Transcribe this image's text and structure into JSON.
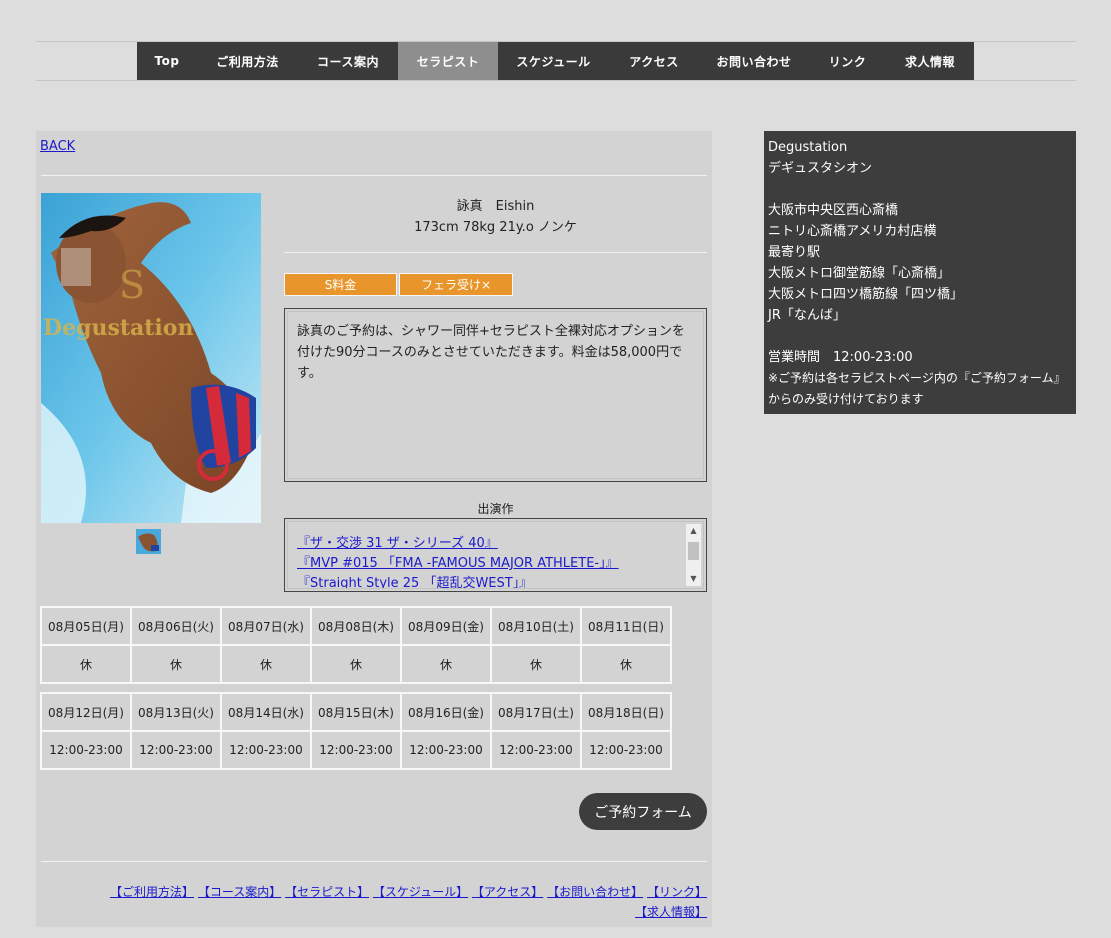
{
  "nav": {
    "items": [
      {
        "label": "Top",
        "name": "nav-top",
        "width": 60
      },
      {
        "label": "ご利用方法",
        "name": "nav-usage",
        "width": 101
      },
      {
        "label": "コース案内",
        "name": "nav-courses",
        "width": 100
      },
      {
        "label": "セラピスト",
        "name": "nav-therapist",
        "width": 100,
        "active": true
      },
      {
        "label": "スケジュール",
        "name": "nav-schedule",
        "width": 111
      },
      {
        "label": "アクセス",
        "name": "nav-access",
        "width": 90
      },
      {
        "label": "お問い合わせ",
        "name": "nav-contact",
        "width": 110
      },
      {
        "label": "リンク",
        "name": "nav-link",
        "width": 77
      },
      {
        "label": "求人情報",
        "name": "nav-recruit",
        "width": 88
      }
    ]
  },
  "back_label": "BACK",
  "profile": {
    "name": "詠真　Eishin",
    "stats": "173cm 78kg 21y.o ノンケ",
    "tags": [
      "S料金",
      "フェラ受け×"
    ],
    "description": "詠真のご予約は、シャワー同伴+セラピスト全裸対応オプションを付けた90分コースのみとさせていただきます。料金は58,000円です。",
    "logo_text": "Degustation"
  },
  "films": {
    "title": "出演作",
    "items": [
      "『ザ・交渉 31 ザ・シリーズ 40』",
      "『MVP #015 「FMA -FAMOUS MAJOR ATHLETE-」』",
      "『Straight Style 25 「超乱交WEST」』"
    ]
  },
  "schedule": {
    "week1": {
      "dates": [
        "08月05日(月)",
        "08月06日(火)",
        "08月07日(水)",
        "08月08日(木)",
        "08月09日(金)",
        "08月10日(土)",
        "08月11日(日)"
      ],
      "hours": [
        "休",
        "休",
        "休",
        "休",
        "休",
        "休",
        "休"
      ]
    },
    "week2": {
      "dates": [
        "08月12日(月)",
        "08月13日(火)",
        "08月14日(水)",
        "08月15日(木)",
        "08月16日(金)",
        "08月17日(土)",
        "08月18日(日)"
      ],
      "hours": [
        "12:00-23:00",
        "12:00-23:00",
        "12:00-23:00",
        "12:00-23:00",
        "12:00-23:00",
        "12:00-23:00",
        "12:00-23:00"
      ]
    }
  },
  "reserve_label": "ご予約フォーム",
  "footer_links": [
    "【ご利用方法】",
    "【コース案内】",
    "【セラピスト】",
    "【スケジュール】",
    "【アクセス】",
    "【お問い合わせ】",
    "【リンク】",
    "【求人情報】"
  ],
  "sidebar": {
    "shop_name": "Degustation",
    "shop_kana": "デギュスタシオン",
    "address1": "大阪市中央区西心斎橋",
    "address2": "ニトリ心斎橋アメリカ村店横",
    "station_title": "最寄り駅",
    "station1": "大阪メトロ御堂筋線「心斎橋」",
    "station2": "大阪メトロ四ツ橋筋線「四ツ橋」",
    "station3": "JR「なんば」",
    "hours": "営業時間　12:00-23:00",
    "note1": "※ご予約は各セラピストページ内の『ご予約フォーム』",
    "note2": "からのみ受け付けております"
  },
  "colors": {
    "accent": "#e8962b",
    "nav_bg": "#3a3a3a",
    "nav_active": "#8e8e8e",
    "link": "#1a1acc"
  }
}
